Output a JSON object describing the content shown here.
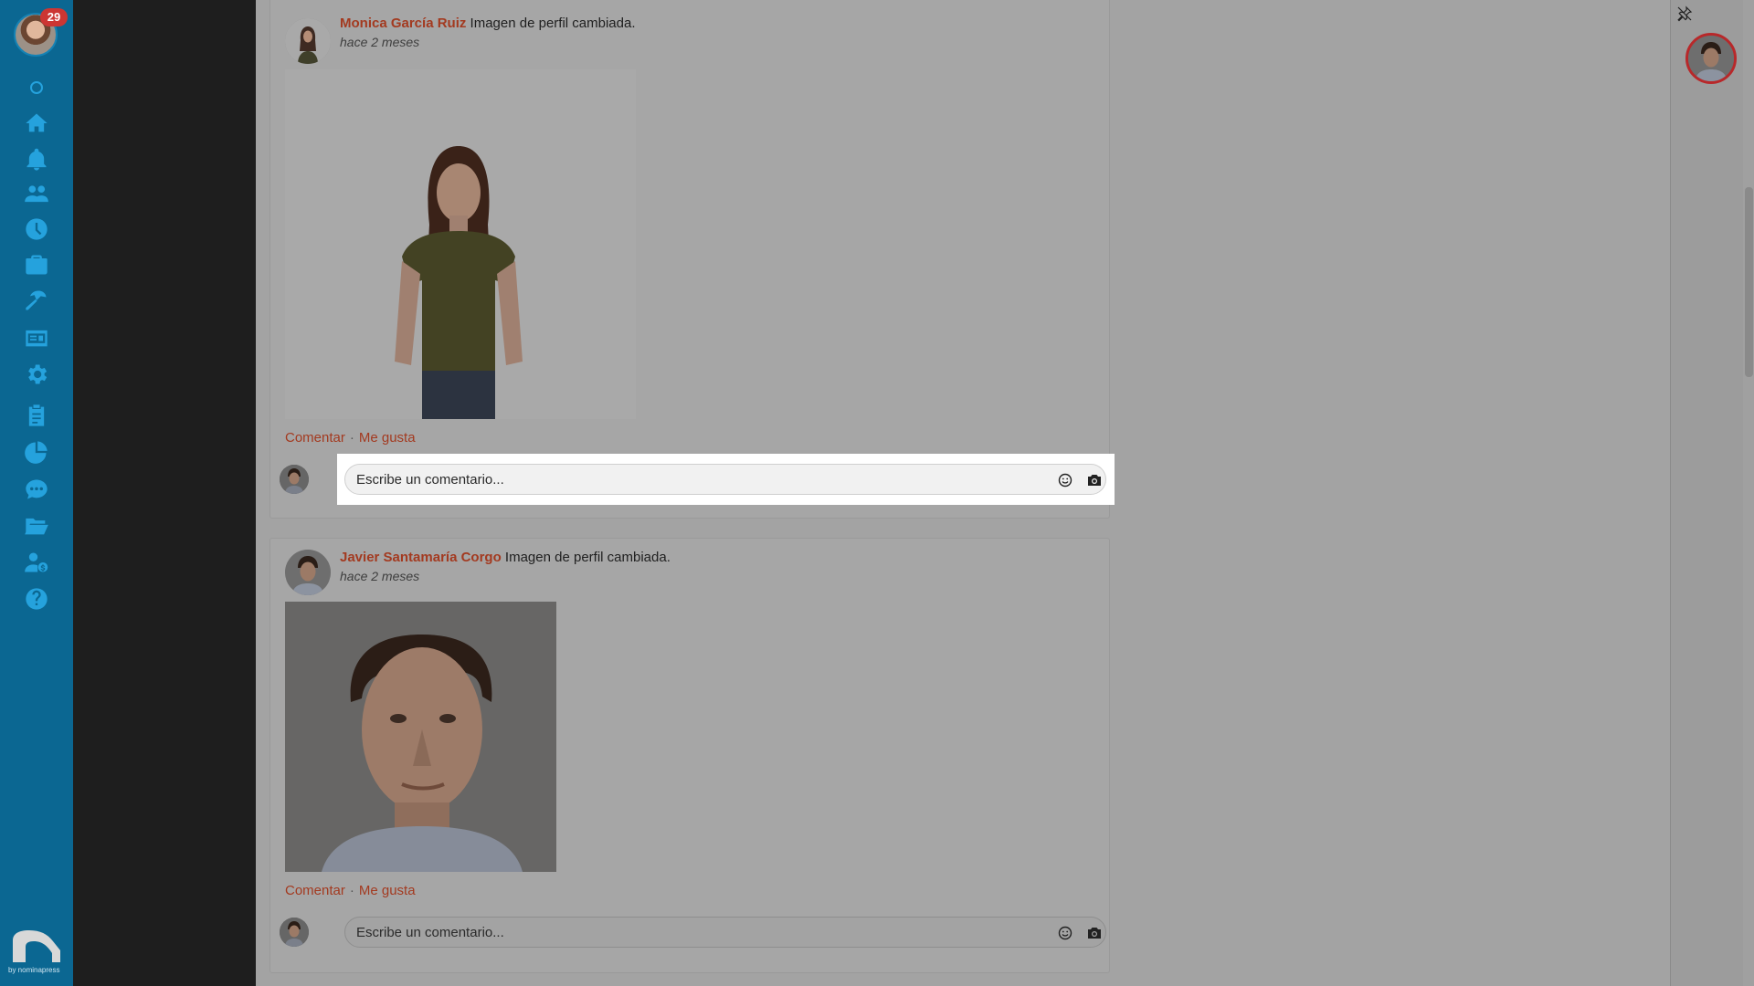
{
  "sidebar": {
    "notification_count": "29",
    "items": [
      {
        "icon": "home-icon"
      },
      {
        "icon": "bell-icon"
      },
      {
        "icon": "users-icon"
      },
      {
        "icon": "clock-icon"
      },
      {
        "icon": "briefcase-icon"
      },
      {
        "icon": "beach-icon"
      },
      {
        "icon": "id-card-icon"
      },
      {
        "icon": "gear-icon"
      },
      {
        "icon": "clipboard-icon"
      },
      {
        "icon": "pie-chart-icon"
      },
      {
        "icon": "chat-icon"
      },
      {
        "icon": "folder-icon"
      },
      {
        "icon": "user-money-icon"
      },
      {
        "icon": "help-icon"
      }
    ],
    "logo_byline": "by nominapress"
  },
  "posts": [
    {
      "author": "Monica García Ruiz",
      "action": "Imagen de perfil cambiada.",
      "time": "hace 2 meses",
      "comment_label": "Comentar",
      "separator": "·",
      "like_label": "Me gusta",
      "comment_placeholder": "Escribe un comentario..."
    },
    {
      "author": "Javier Santamaría Corgo",
      "action": "Imagen de perfil cambiada.",
      "time": "hace 2 meses",
      "comment_label": "Comentar",
      "separator": "·",
      "like_label": "Me gusta",
      "comment_placeholder": "Escribe un comentario..."
    }
  ],
  "colors": {
    "sidebar_bg": "#0b6792",
    "sidebar_icon": "#25a2dd",
    "author_link": "#a33a20",
    "badge": "#cc3633",
    "overlay": "#a3a3a3"
  }
}
